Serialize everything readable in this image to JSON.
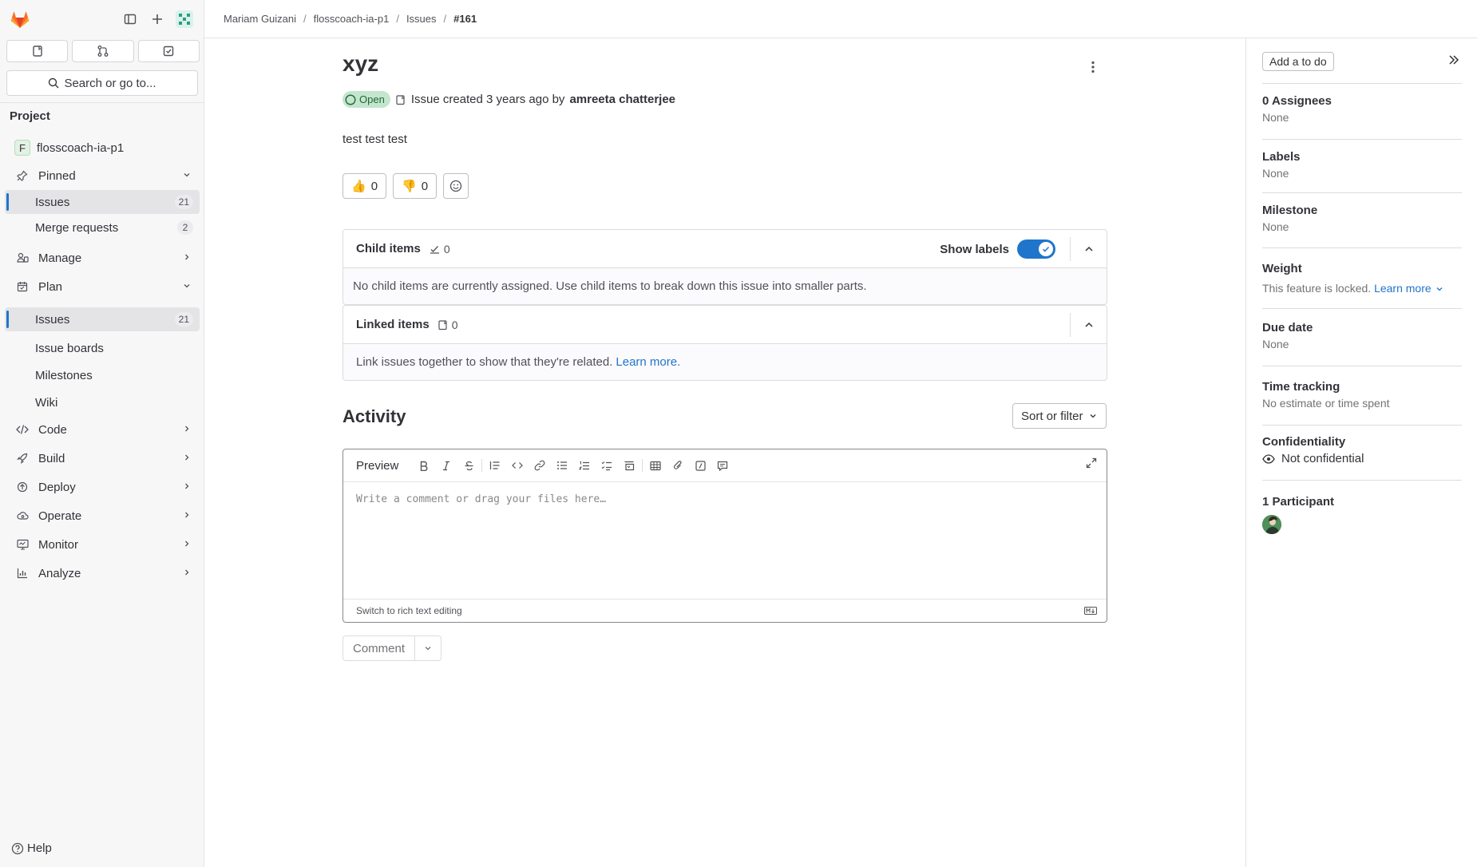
{
  "breadcrumb": [
    "Mariam Guizani",
    "flosscoach-ia-p1",
    "Issues",
    "#161"
  ],
  "sidebar": {
    "search_label": "Search or go to...",
    "section_title": "Project",
    "project_initial": "F",
    "project_name": "flosscoach-ia-p1",
    "pinned_label": "Pinned",
    "pinned_items": [
      {
        "label": "Issues",
        "count": "21"
      },
      {
        "label": "Merge requests",
        "count": "2"
      }
    ],
    "manage_label": "Manage",
    "plan_label": "Plan",
    "plan_items": [
      {
        "label": "Issues",
        "count": "21"
      },
      {
        "label": "Issue boards"
      },
      {
        "label": "Milestones"
      },
      {
        "label": "Wiki"
      }
    ],
    "groups": [
      "Code",
      "Build",
      "Deploy",
      "Operate",
      "Monitor",
      "Analyze"
    ],
    "help_label": "Help"
  },
  "issue": {
    "title": "xyz",
    "status": "Open",
    "created_text": "Issue created 3 years ago by",
    "author": "amreeta chatterjee",
    "description": "test test test",
    "thumbs_up": "0",
    "thumbs_down": "0"
  },
  "child_items": {
    "title": "Child items",
    "count": "0",
    "show_labels": "Show labels",
    "empty_text": "No child items are currently assigned. Use child items to break down this issue into smaller parts."
  },
  "linked_items": {
    "title": "Linked items",
    "count": "0",
    "empty_text": "Link issues together to show that they're related.",
    "learn_more": "Learn more."
  },
  "activity": {
    "title": "Activity",
    "sort_label": "Sort or filter",
    "preview_tab": "Preview",
    "placeholder": "Write a comment or drag your files here…",
    "switch_label": "Switch to rich text editing",
    "comment_label": "Comment"
  },
  "right_sidebar": {
    "todo_label": "Add a to do",
    "assignees_title": "0 Assignees",
    "assignees_value": "None",
    "labels_title": "Labels",
    "labels_value": "None",
    "milestone_title": "Milestone",
    "milestone_value": "None",
    "weight_title": "Weight",
    "weight_value": "This feature is locked.",
    "weight_link": "Learn more",
    "due_title": "Due date",
    "due_value": "None",
    "time_title": "Time tracking",
    "time_value": "No estimate or time spent",
    "conf_title": "Confidentiality",
    "conf_value": "Not confidential",
    "participants_title": "1 Participant"
  },
  "colors": {
    "accent": "#1f75cb",
    "open_badge_bg": "#c3e6cd",
    "open_badge_text": "#24663b"
  }
}
